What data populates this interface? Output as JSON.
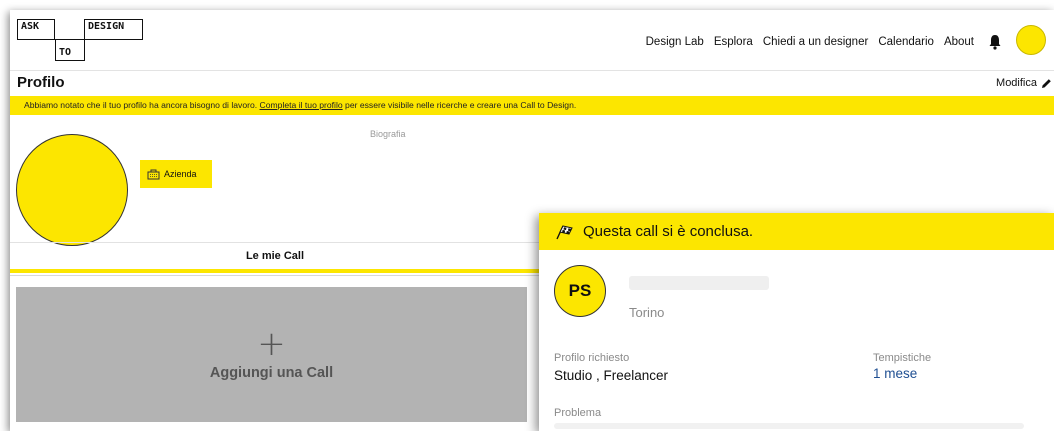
{
  "logo": {
    "ask": "ASK",
    "to": "TO",
    "design": "DESIGN"
  },
  "nav": {
    "items": [
      "Design Lab",
      "Esplora",
      "Chiedi a un designer",
      "Calendario",
      "About"
    ]
  },
  "profile": {
    "title": "Profilo",
    "edit_label": "Modifica",
    "notice_before": "Abbiamo notato che il tuo profilo ha ancora bisogno di lavoro. ",
    "notice_link": "Completa il tuo profilo",
    "notice_after": " per essere visibile nelle ricerche e creare una Call to Design.",
    "bio_label": "Biografia",
    "company_label": "Azienda",
    "tab_label": "Le mie Call",
    "add_call_label": "Aggiungi una Call",
    "add_call_symbol": "+"
  },
  "card": {
    "status": "Questa call si è conclusa.",
    "initials": "PS",
    "city": "Torino",
    "profile_label": "Profilo richiesto",
    "profile_value": "Studio , Freelancer",
    "timing_label": "Tempistiche",
    "timing_value": "1 mese",
    "problem_label": "Problema"
  },
  "colors": {
    "accent": "#FCE600",
    "link_blue": "#1f4f92",
    "add_gray": "#b3b3b3"
  }
}
